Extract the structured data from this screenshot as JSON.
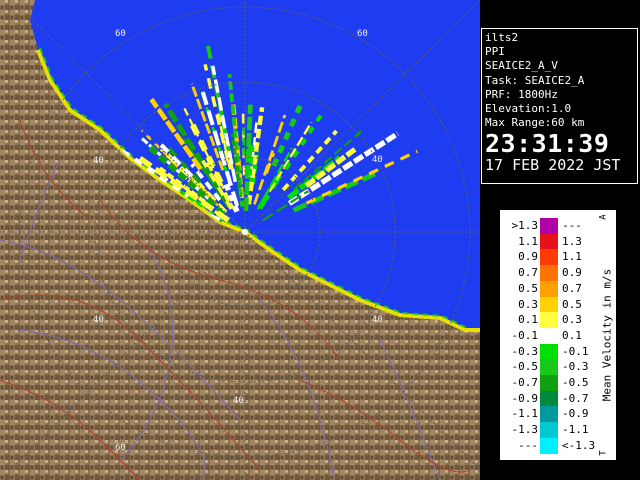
{
  "info": {
    "lines": [
      "ilts2",
      "PPI",
      "SEAICE2_A_V",
      "Task: SEAICE2_A",
      "PRF: 1800Hz",
      "Elevation:1.0",
      "Max Range:60 km"
    ],
    "time": "23:31:39",
    "date": "17 FEB 2022 JST"
  },
  "legend": {
    "title": "Mean Velocity in m/s",
    "top_mark": "A",
    "bottom_mark": "T",
    "rows": [
      {
        "lo": ">1.3",
        "hi": "---",
        "color": "#b000a8"
      },
      {
        "lo": "1.1",
        "hi": "1.3",
        "color": "#e8101a"
      },
      {
        "lo": "0.9",
        "hi": "1.1",
        "color": "#ff3a00"
      },
      {
        "lo": "0.7",
        "hi": "0.9",
        "color": "#ff7200"
      },
      {
        "lo": "0.5",
        "hi": "0.7",
        "color": "#ffa000"
      },
      {
        "lo": "0.3",
        "hi": "0.5",
        "color": "#ffd200"
      },
      {
        "lo": "0.1",
        "hi": "0.3",
        "color": "#ffff40"
      },
      {
        "lo": "-0.1",
        "hi": "0.1",
        "color": "#ffffff"
      },
      {
        "lo": "-0.3",
        "hi": "-0.1",
        "color": "#00e000"
      },
      {
        "lo": "-0.5",
        "hi": "-0.3",
        "color": "#18c818"
      },
      {
        "lo": "-0.7",
        "hi": "-0.5",
        "color": "#10a010"
      },
      {
        "lo": "-0.9",
        "hi": "-0.7",
        "color": "#008a40"
      },
      {
        "lo": "-1.1",
        "hi": "-0.9",
        "color": "#009a9a"
      },
      {
        "lo": "-1.3",
        "hi": "-1.1",
        "color": "#00c8d0"
      },
      {
        "lo": "---",
        "hi": "<-1.3",
        "color": "#00f0ff"
      }
    ]
  },
  "radar": {
    "sea_color": "#1e3cf0",
    "land_color": "#8a7050",
    "range_labels": [
      {
        "text": "60"
      },
      {
        "text": "60"
      },
      {
        "text": "40"
      },
      {
        "text": "40"
      },
      {
        "text": "40"
      },
      {
        "text": "40"
      },
      {
        "text": "40"
      },
      {
        "text": "60"
      }
    ]
  }
}
